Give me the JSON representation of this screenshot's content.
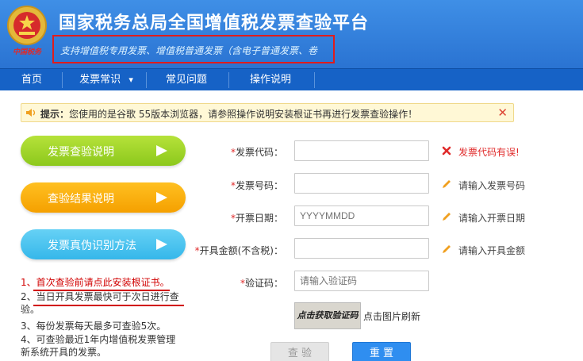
{
  "header": {
    "title": "国家税务总局全国增值税发票查验平台",
    "subtitle": "支持增值税专用发票、增值税普通发票（含电子普通发票、卷",
    "emblem_text": "中国税务"
  },
  "nav": {
    "items": [
      {
        "label": "首页"
      },
      {
        "label": "发票常识"
      },
      {
        "label": "常见问题"
      },
      {
        "label": "操作说明"
      }
    ],
    "dropdown_icon": "▾"
  },
  "notice": {
    "prefix": "提示：",
    "text": "您使用的是谷歌 55版本浏览器，请参照操作说明安装根证书再进行发票查验操作！",
    "close": "✕"
  },
  "guides": {
    "items": [
      {
        "label": "发票查验说明"
      },
      {
        "label": "查验结果说明"
      },
      {
        "label": "发票真伪识别方法"
      }
    ]
  },
  "tips": {
    "lines": [
      "1、首次查验前请点此安装根证书。",
      "2、当日开具发票最快可于次日进行查",
      "验。",
      "3、每份发票每天最多可查验5次。",
      "4、可查验最近1年内增值税发票管理",
      "新系统开具的发票。"
    ]
  },
  "form": {
    "required_mark": "*",
    "fields": [
      {
        "label": "发票代码：",
        "value": "",
        "placeholder": "",
        "hint": "发票代码有误!"
      },
      {
        "label": "发票号码：",
        "value": "",
        "placeholder": "",
        "hint": "请输入发票号码"
      },
      {
        "label": "开票日期：",
        "value": "",
        "placeholder": "YYYYMMDD",
        "hint": "请输入开票日期"
      },
      {
        "label": "开具金额(不含税)：",
        "value": "",
        "placeholder": "",
        "hint": "请输入开具金额"
      },
      {
        "label": "验证码：",
        "value": "",
        "placeholder": "请输入验证码",
        "hint": ""
      }
    ],
    "captcha_image_text": "点击获取验证码",
    "captcha_refresh": "点击图片刷新",
    "check_button": "查 验",
    "reset_button": "重 置"
  },
  "colors": {
    "header_blue": "#2a73d2",
    "nav_blue": "#1662c6",
    "error_red": "#e02a2a",
    "green_pill": "#8cc81c",
    "orange_pill": "#f5a000",
    "blue_pill": "#35b7ea",
    "reset_blue": "#2f8ef0"
  },
  "icons": {
    "emblem": "tax-emblem-icon",
    "notice": "speaker-icon",
    "error": "cross-icon",
    "hint": "pencil-icon",
    "arrow": "play-arrow-icon"
  }
}
